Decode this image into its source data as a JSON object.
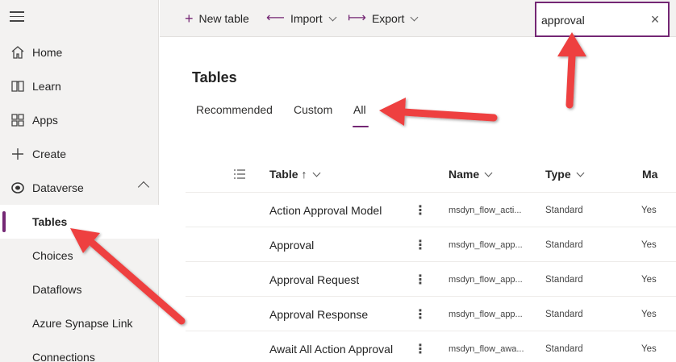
{
  "sidebar": {
    "items": [
      {
        "label": "Home",
        "icon": "home-icon"
      },
      {
        "label": "Learn",
        "icon": "book-icon"
      },
      {
        "label": "Apps",
        "icon": "apps-icon"
      },
      {
        "label": "Create",
        "icon": "plus-icon"
      },
      {
        "label": "Dataverse",
        "icon": "dataverse-icon"
      }
    ],
    "subitems": [
      {
        "label": "Tables",
        "active": true
      },
      {
        "label": "Choices"
      },
      {
        "label": "Dataflows"
      },
      {
        "label": "Azure Synapse Link"
      },
      {
        "label": "Connections"
      }
    ]
  },
  "toolbar": {
    "new_table": "New table",
    "import": "Import",
    "export": "Export"
  },
  "search": {
    "value": "approval"
  },
  "page": {
    "title": "Tables"
  },
  "tabs": [
    {
      "label": "Recommended"
    },
    {
      "label": "Custom"
    },
    {
      "label": "All",
      "active": true
    }
  ],
  "table": {
    "headers": {
      "table": "Table",
      "sort_arrow": "↑",
      "name": "Name",
      "type": "Type",
      "managed": "Ma"
    },
    "rows": [
      {
        "display": "Action Approval Model",
        "name": "msdyn_flow_acti...",
        "type": "Standard",
        "managed": "Yes"
      },
      {
        "display": "Approval",
        "name": "msdyn_flow_app...",
        "type": "Standard",
        "managed": "Yes"
      },
      {
        "display": "Approval Request",
        "name": "msdyn_flow_app...",
        "type": "Standard",
        "managed": "Yes"
      },
      {
        "display": "Approval Response",
        "name": "msdyn_flow_app...",
        "type": "Standard",
        "managed": "Yes"
      },
      {
        "display": "Await All Action Approval",
        "name": "msdyn_flow_awa...",
        "type": "Standard",
        "managed": "Yes"
      }
    ]
  },
  "colors": {
    "accent": "#742774",
    "annotation_arrow": "#ee4040"
  }
}
